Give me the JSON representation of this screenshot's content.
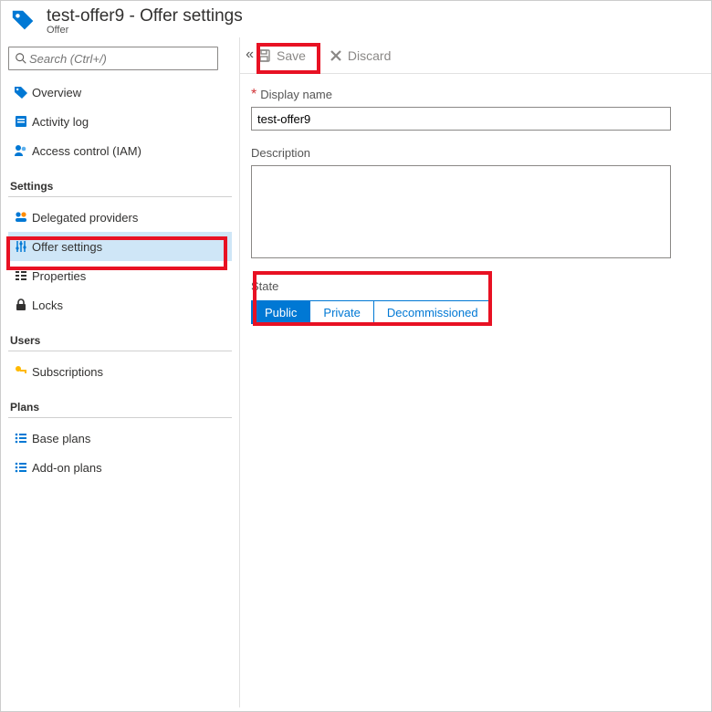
{
  "header": {
    "title": "test-offer9 - Offer settings",
    "subtitle": "Offer"
  },
  "search": {
    "placeholder": "Search (Ctrl+/)"
  },
  "nav": {
    "top": [
      {
        "label": "Overview"
      },
      {
        "label": "Activity log"
      },
      {
        "label": "Access control (IAM)"
      }
    ],
    "settings_label": "Settings",
    "settings": [
      {
        "label": "Delegated providers"
      },
      {
        "label": "Offer settings"
      },
      {
        "label": "Properties"
      },
      {
        "label": "Locks"
      }
    ],
    "users_label": "Users",
    "users": [
      {
        "label": "Subscriptions"
      }
    ],
    "plans_label": "Plans",
    "plans": [
      {
        "label": "Base plans"
      },
      {
        "label": "Add-on plans"
      }
    ]
  },
  "commands": {
    "save": "Save",
    "discard": "Discard"
  },
  "form": {
    "display_name_label": "Display name",
    "display_name_value": "test-offer9",
    "description_label": "Description",
    "description_value": "",
    "state_label": "State",
    "state_options": {
      "public": "Public",
      "private": "Private",
      "decommissioned": "Decommissioned"
    },
    "state_selected": "Public"
  }
}
